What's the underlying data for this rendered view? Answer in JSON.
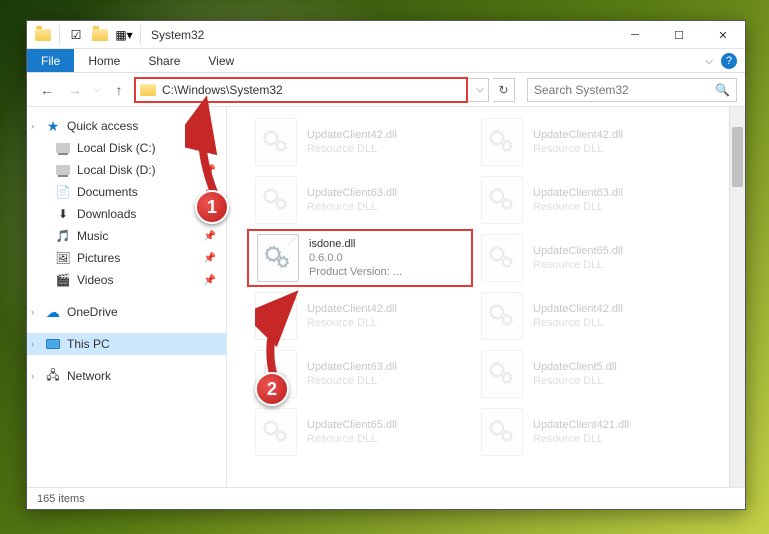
{
  "window": {
    "title": "System32"
  },
  "tabs": {
    "file": "File",
    "home": "Home",
    "share": "Share",
    "view": "View"
  },
  "address": {
    "path": "C:\\Windows\\System32"
  },
  "search": {
    "placeholder": "Search System32"
  },
  "sidebar": {
    "quickAccess": "Quick access",
    "items": [
      {
        "label": "Local Disk (C:)"
      },
      {
        "label": "Local Disk (D:)"
      },
      {
        "label": "Documents"
      },
      {
        "label": "Downloads"
      },
      {
        "label": "Music"
      },
      {
        "label": "Pictures"
      },
      {
        "label": "Videos"
      }
    ],
    "onedrive": "OneDrive",
    "thispc": "This PC",
    "network": "Network"
  },
  "files": [
    {
      "name": "UpdateClient42.dll",
      "meta": "Resource DLL"
    },
    {
      "name": "UpdateClient42.dll",
      "meta": "Resource DLL"
    },
    {
      "name": "UpdateClient63.dll",
      "meta": "Resource DLL"
    },
    {
      "name": "UpdateClient63.dll",
      "meta": "Resource DLL"
    },
    {
      "name": "isdone.dll",
      "meta1": "0.6.0.0",
      "meta2": "Product Version:    ..."
    },
    {
      "name": "UpdateClient65.dll",
      "meta": "Resource DLL"
    },
    {
      "name": "UpdateClient42.dll",
      "meta": "Resource DLL"
    },
    {
      "name": "UpdateClient42.dll",
      "meta": "Resource DLL"
    },
    {
      "name": "UpdateClient63.dll",
      "meta": "Resource DLL"
    },
    {
      "name": "UpdateClient5.dll",
      "meta": "Resource DLL"
    },
    {
      "name": "UpdateClient65.dll",
      "meta": "Resource DLL"
    },
    {
      "name": "UpdateClient421.dll",
      "meta": "Resource DLL"
    }
  ],
  "status": {
    "count": "165 items"
  },
  "annotations": {
    "one": "1",
    "two": "2"
  }
}
